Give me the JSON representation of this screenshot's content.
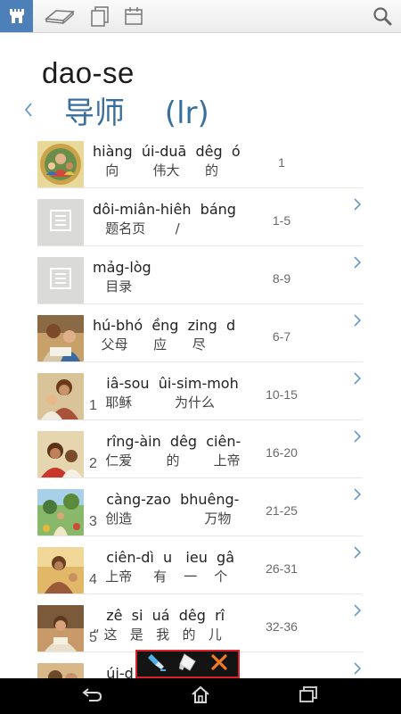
{
  "toolbar": {
    "items": [
      {
        "icon": "library-icon",
        "active": true
      },
      {
        "icon": "open-book-icon"
      },
      {
        "icon": "pages-icon"
      },
      {
        "icon": "calendar-icon"
      },
      {
        "icon": "search-icon"
      }
    ]
  },
  "header": {
    "title": "dao-se",
    "subtitle": "导师　 (lr)"
  },
  "chapters": [
    {
      "number": "",
      "line1": "hiàng  úi-duā  dêg  ó",
      "line2": "   向        伟大      的",
      "pages": "1",
      "thumb": "illustration"
    },
    {
      "number": "",
      "line1": "dôi-miân-hiêh  báng",
      "line2": "   题名页       /",
      "pages": "1-5",
      "thumb": "placeholder"
    },
    {
      "number": "",
      "line1": "mảg-lòg",
      "line2": "   目录",
      "pages": "8-9",
      "thumb": "placeholder"
    },
    {
      "number": "",
      "line1": "hú-bhó  ềng  zing  d",
      "line2": "  父母      应      尽",
      "pages": "6-7",
      "thumb": "illustration"
    },
    {
      "number": "1",
      "line1": "   iâ-sou  ûi-sim-moh",
      "line2": "   耶稣          为什么",
      "pages": "10-15",
      "thumb": "illustration"
    },
    {
      "number": "2",
      "line1": "   rîng-àin  dêg  ciên-",
      "line2": "   仁爱        的        上帝",
      "pages": "16-20",
      "thumb": "illustration"
    },
    {
      "number": "3",
      "line1": "   càng-zao  bhuêng-",
      "line2": "   创造                 万物",
      "pages": "21-25",
      "thumb": "illustration"
    },
    {
      "number": "4",
      "line1": "   ciên-dì  u   ieu  gâ",
      "line2": "   上帝     有    一    个",
      "pages": "26-31",
      "thumb": "illustration"
    },
    {
      "number": "5",
      "line1": "   zê  si  uá  dêg  rî",
      "line2": "“ 这   是   我   的   儿",
      "pages": "32-36",
      "thumb": "illustration"
    },
    {
      "number": "",
      "line1": "   úi-d",
      "line2": "",
      "pages": "",
      "thumb": "illustration"
    }
  ],
  "highlight_toolbar": {
    "items": [
      {
        "icon": "highlighter-icon"
      },
      {
        "icon": "eraser-icon"
      },
      {
        "icon": "close-icon"
      }
    ]
  },
  "navbar": {
    "items": [
      {
        "icon": "back-icon"
      },
      {
        "icon": "home-icon"
      },
      {
        "icon": "recent-apps-icon"
      }
    ]
  },
  "colors": {
    "accent": "#4d7fb9",
    "subtitle": "#3a6f9c",
    "chevron": "#6a9ac9",
    "highlight_border": "#d8232a",
    "close": "#f07b22"
  }
}
